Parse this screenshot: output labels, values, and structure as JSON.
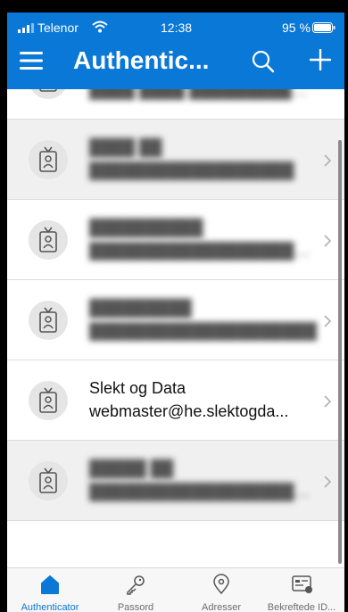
{
  "status": {
    "carrier": "Telenor",
    "time": "12:38",
    "battery": "95 %"
  },
  "appbar": {
    "title": "Authentic..."
  },
  "accounts": [
    {
      "name": "",
      "email": "████ ████ ███████████████"
    },
    {
      "name": "████ ██",
      "email": "██████████████████"
    },
    {
      "name": "██████████",
      "email": "█████████████████████"
    },
    {
      "name": "█████████",
      "email": "████████████████████"
    },
    {
      "name": "Slekt og Data",
      "email": "webmaster@he.slektogda..."
    },
    {
      "name": "█████ ██",
      "email": "████████████████████..."
    }
  ],
  "tabs": [
    {
      "label": "Authenticator"
    },
    {
      "label": "Passord"
    },
    {
      "label": "Adresser"
    },
    {
      "label": "Bekreftede ID..."
    }
  ],
  "colors": {
    "accent": "#0a78d7"
  }
}
